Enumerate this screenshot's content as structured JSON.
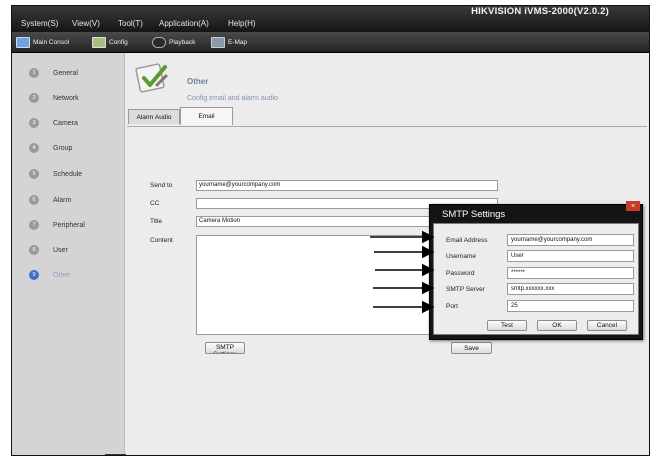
{
  "app": {
    "title": "HIKVISION iVMS-2000(V2.0.2)"
  },
  "menu": [
    {
      "label": "System(S)"
    },
    {
      "label": "View(V)"
    },
    {
      "label": "Tool(T)"
    },
    {
      "label": "Application(A)"
    },
    {
      "label": "Help(H)"
    }
  ],
  "toolbar": [
    {
      "label": "Main Consol",
      "icon": "monitor-icon"
    },
    {
      "label": "Config",
      "icon": "config-icon"
    },
    {
      "label": "Playback",
      "icon": "playback-icon"
    },
    {
      "label": "E-Map",
      "icon": "emap-icon"
    }
  ],
  "sidebar": {
    "items": [
      {
        "num": "1",
        "label": "General"
      },
      {
        "num": "2",
        "label": "Network"
      },
      {
        "num": "3",
        "label": "Camera"
      },
      {
        "num": "4",
        "label": "Group"
      },
      {
        "num": "5",
        "label": "Schedule"
      },
      {
        "num": "6",
        "label": "Alarm"
      },
      {
        "num": "7",
        "label": "Peripheral"
      },
      {
        "num": "8",
        "label": "User"
      },
      {
        "num": "9",
        "label": "Other"
      }
    ],
    "active_index": 8
  },
  "page": {
    "title": "Other",
    "subtitle": "Config email and alarm audio",
    "tabs": [
      {
        "label": "Alarm Audio"
      },
      {
        "label": "Email"
      }
    ],
    "active_tab": 1
  },
  "email_form": {
    "send_to_label": "Send to",
    "send_to_value": "yourname@yourcompany.com",
    "cc_label": "CC",
    "cc_value": "",
    "title_label": "Title",
    "title_value": "Camera Motion",
    "content_label": "Content",
    "smtp_button": "SMTP Settings",
    "save_button": "Save"
  },
  "smtp_dialog": {
    "title": "SMTP Settings",
    "close": "×",
    "email_label": "Email Address",
    "email_value": "yourname@yourcompany.com",
    "username_label": "Username",
    "username_value": "User",
    "password_label": "Password",
    "password_value": "******",
    "server_label": "SMTP Server",
    "server_value": "smtp.xxxxxx.xxx",
    "port_label": "Port",
    "port_value": "25",
    "test_button": "Test",
    "ok_button": "OK",
    "cancel_button": "Cancel"
  },
  "colors": {
    "menubar": "#1e1e1e",
    "accent_active": "#3f6fc9",
    "page_title": "#6d7fa0",
    "close_button": "#c83a2a"
  }
}
